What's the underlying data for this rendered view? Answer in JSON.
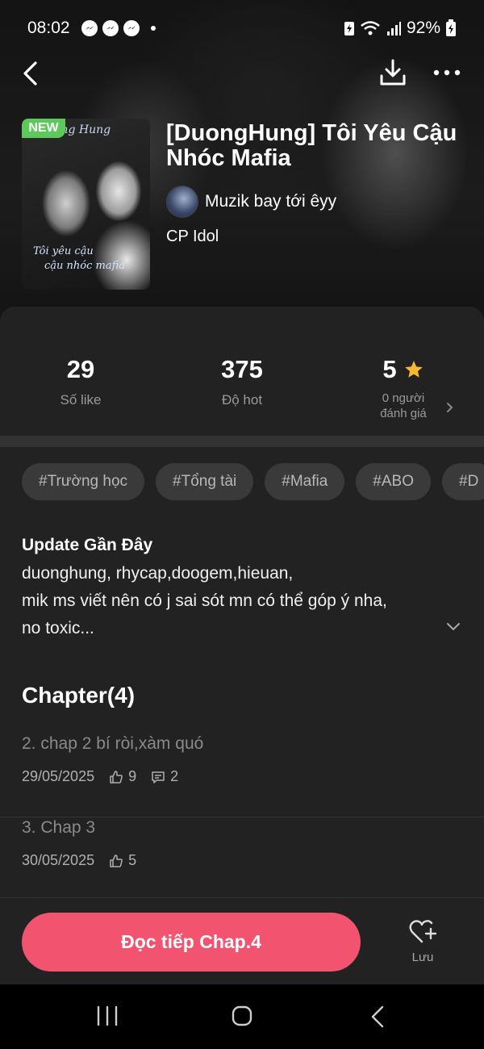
{
  "status_bar": {
    "time": "08:02",
    "battery": "92%"
  },
  "colors": {
    "accent": "#f2536f",
    "new_badge": "#5cc95a",
    "star": "#f7b731",
    "panel_bg": "#222222",
    "tag_bg": "#3a3a3a"
  },
  "icons": {
    "back": "chevron-left-icon",
    "download": "download-icon",
    "more": "more-horizontal-icon",
    "star": "star-icon",
    "like": "thumbs-up-icon",
    "comment": "comment-icon",
    "save": "heart-plus-icon"
  },
  "cover": {
    "badge": "NEW",
    "title_text": "ong Hung",
    "script_line1": "Tôi yêu cậu",
    "script_line2": "cậu nhóc mafia"
  },
  "story": {
    "title": "[DuongHung] Tôi Yêu Cậu Nhóc Mafia",
    "author": "Muzik bay tới êyy",
    "category": "CP Idol"
  },
  "stats": {
    "likes_value": "29",
    "likes_label": "Số like",
    "hot_value": "375",
    "hot_label": "Độ hot",
    "rating_value": "5",
    "rating_label_line1": "0 người",
    "rating_label_line2": "đánh giá"
  },
  "tags": [
    "#Trường học",
    "#Tổng tài",
    "#Mafia",
    "#ABO",
    "#D"
  ],
  "update": {
    "title": "Update Gần Đây",
    "line1": "duonghung, rhycap,doogem,hieuan,",
    "line2": "mik ms viết nên có j sai sót mn có thể góp ý nha,",
    "line3": "no toxic..."
  },
  "chapters": {
    "heading": "Chapter(4)",
    "items": [
      {
        "name": "2. chap 2 bí ròi,xàm quó",
        "date": "29/05/2025",
        "likes": "9",
        "comments": "2"
      },
      {
        "name": "3. Chap 3",
        "date": "30/05/2025",
        "likes": "5"
      }
    ]
  },
  "actions": {
    "read_label": "Đọc tiếp Chap.4",
    "save_label": "Lưu"
  }
}
